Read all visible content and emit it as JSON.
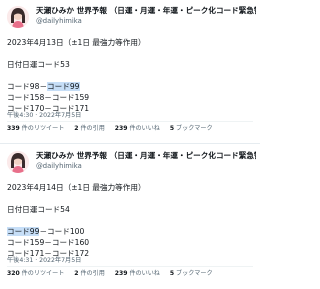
{
  "tweets": [
    {
      "display_name": "天瀬ひみか 世界予報 （日運・月運・年運・ピーク化コード緊急警...",
      "handle": "@dailyhimika",
      "lines": [
        {
          "text": "2023年4月13日（±1日 最強力等作用）"
        },
        {
          "gap": true
        },
        {
          "text": "日付日運コード53"
        },
        {
          "gap": true
        },
        {
          "pre": "コード98－",
          "hl": "コード99",
          "post": ""
        },
        {
          "text": "コード158－コード159"
        },
        {
          "text": "コード170－コード171"
        }
      ],
      "timestamp": "午後4:30 · 2022年7月5日",
      "stats": {
        "retweets_count": "339",
        "retweets_label": "件のリツイート",
        "quotes_count": "2",
        "quotes_label": "件の引用",
        "likes_count": "239",
        "likes_label": "件のいいね",
        "bookmarks_count": "5",
        "bookmarks_label": "ブックマーク"
      }
    },
    {
      "display_name": "天瀬ひみか 世界予報 （日運・月運・年運・ピーク化コード緊急警...",
      "handle": "@dailyhimika",
      "lines": [
        {
          "text": "2023年4月14日（±1日 最強力等作用）"
        },
        {
          "gap": true
        },
        {
          "text": "日付日運コード54"
        },
        {
          "gap": true
        },
        {
          "pre": "",
          "hl": "コード99",
          "post": "－コード100"
        },
        {
          "text": "コード159－コード160"
        },
        {
          "text": "コード171－コード172"
        }
      ],
      "timestamp": "午後4:31 · 2022年7月5日",
      "stats": {
        "retweets_count": "320",
        "retweets_label": "件のリツイート",
        "quotes_count": "2",
        "quotes_label": "件の引用",
        "likes_count": "239",
        "likes_label": "件のいいね",
        "bookmarks_count": "5",
        "bookmarks_label": "ブックマーク"
      }
    }
  ]
}
